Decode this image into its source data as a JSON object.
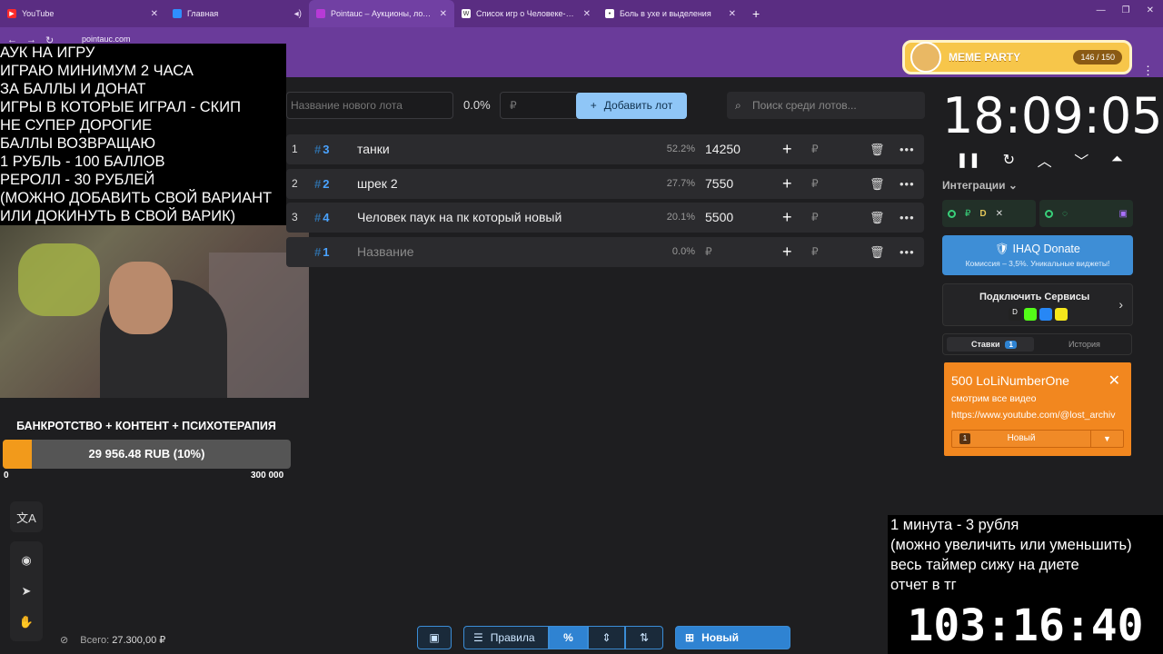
{
  "browser": {
    "tabs": [
      {
        "label": "YouTube",
        "icon_color": "#ff2a2a"
      },
      {
        "label": "Главная",
        "icon_color": "#2f8fff"
      },
      {
        "label": "Pointauc – Аукционы, лотереи…",
        "icon_color": "#b73ad6"
      },
      {
        "label": "Список игр о Человеке-пауке…",
        "icon_color": "#ffffff"
      },
      {
        "label": "Боль в ухе и выделения",
        "icon_color": "#ffffff"
      }
    ],
    "url": "pointauc.com"
  },
  "meme_widget": {
    "title": "MEME PARTY",
    "count": "146 / 150"
  },
  "overlay_left": [
    "АУК НА ИГРУ",
    "ИГРАЮ МИНИМУМ 2 ЧАСА",
    "ЗА БАЛЛЫ И ДОНАТ",
    "ИГРЫ В КОТОРЫЕ ИГРАЛ - СКИП",
    "НЕ СУПЕР ДОРОГИЕ",
    "БАЛЛЫ ВОЗВРАЩАЮ",
    "1 РУБЛЬ - 100 БАЛЛОВ",
    "РЕРОЛЛ - 30 РУБЛЕЙ",
    "(МОЖНО ДОБАВИТЬ СВОЙ ВАРИАНТ",
    "ИЛИ ДОКИНУТЬ В СВОЙ ВАРИК)"
  ],
  "donation_goal": {
    "title": "БАНКРОТСТВО + КОНТЕНТ + ПСИХОТЕРАПИЯ",
    "progress_text": "29 956.48 RUB (10%)",
    "progress_fraction": 0.1,
    "min": "0",
    "max": "300 000"
  },
  "toolbar": {
    "lot_name_placeholder": "Название нового лота",
    "percent": "0.0%",
    "amount_placeholder": "₽",
    "add_label": "Добавить лот",
    "search_placeholder": "Поиск среди лотов..."
  },
  "lots": [
    {
      "index": "1",
      "id": "3",
      "name": "танки",
      "percent": "52.2%",
      "amount": "14250"
    },
    {
      "index": "2",
      "id": "2",
      "name": "шрек 2",
      "percent": "27.7%",
      "amount": "7550"
    },
    {
      "index": "3",
      "id": "4",
      "name": "Человек паук на пк который новый",
      "percent": "20.1%",
      "amount": "5500"
    },
    {
      "index": "",
      "id": "1",
      "name": "Название",
      "percent": "0.0%",
      "amount": "₽"
    }
  ],
  "currency": "₽",
  "total": {
    "label": "Всего:",
    "value": "27.300,00 ₽"
  },
  "bottombar": {
    "rules_label": "Правила",
    "pct_label": "%",
    "new_auction_label": "Новый аукцион"
  },
  "timer": {
    "value": "18:09:05"
  },
  "integrations": {
    "label": "Интеграции"
  },
  "ihaq": {
    "title": "IHAQ Donate",
    "subtitle": "Комиссия – 3,5%. Уникальные виджеты!"
  },
  "connect": {
    "title": "Подключить Сервисы"
  },
  "bets": {
    "tab_bets": "Ставки",
    "bets_count": "1",
    "tab_history": "История"
  },
  "bid_card": {
    "name": "500 LoLiNumberOne",
    "message1": "смотрим все видео",
    "message2": "https://www.youtube.com/@lost_archiv",
    "select_num": "1",
    "select_label": "Новый"
  },
  "overlay_right": {
    "lines": [
      "1 минута - 3 рубля",
      "(можно увеличить или уменьшить)",
      "весь таймер сижу на диете",
      "отчет в тг"
    ],
    "countdown": "103:16:40"
  },
  "colors": {
    "accent_purple": "#6a3b9a",
    "accent_blue": "#2f83d2",
    "donation_orange": "#f2871f"
  }
}
